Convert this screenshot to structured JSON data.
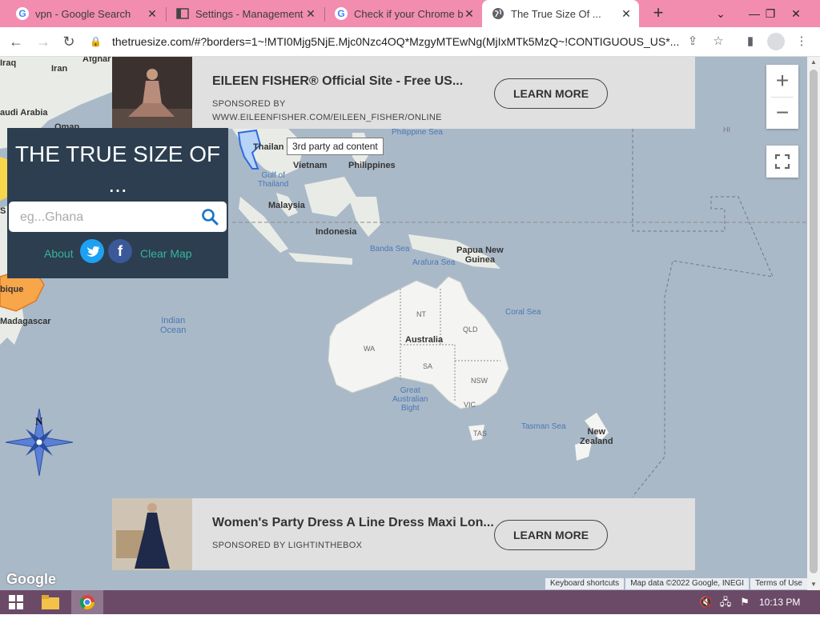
{
  "browser": {
    "tabs": [
      {
        "title": "vpn - Google Search",
        "icon": "google-icon",
        "active": false
      },
      {
        "title": "Settings - Management",
        "icon": "settings-page-icon",
        "active": false
      },
      {
        "title": "Check if your Chrome br",
        "icon": "google-icon",
        "active": false
      },
      {
        "title": "The True Size Of ...",
        "icon": "globe-icon",
        "active": true
      }
    ],
    "url": "thetruesize.com/#?borders=1~!MTI0Mjg5NjE.Mjc0Nzc4OQ*MzgyMTEwNg(MjIxMTk5MzQ~!CONTIGUOUS_US*..."
  },
  "site": {
    "panel_title": "THE TRUE SIZE OF ...",
    "search_placeholder": "eg...Ghana",
    "about_label": "About",
    "clear_label": "Clear Map"
  },
  "ads": {
    "top": {
      "title": "EILEEN FISHER® Official Site - Free US...",
      "sponsor_line1": "SPONSORED BY",
      "sponsor_line2": "WWW.EILEENFISHER.COM/EILEEN_FISHER/ONLINE",
      "cta": "LEARN MORE"
    },
    "bottom": {
      "title": "Women's Party Dress A Line Dress Maxi Lon...",
      "sponsor_line1": "SPONSORED BY LIGHTINTHEBOX",
      "cta": "LEARN MORE"
    },
    "tooltip": "3rd party ad content"
  },
  "map": {
    "labels": {
      "iraq": "Iraq",
      "iran": "Iran",
      "afghan": "Afghar",
      "saudi": "audi Arabia",
      "oman": "Oman",
      "thailand": "Thailan",
      "gulf_thailand": "Gulf of\nThailand",
      "vietnam": "Vietnam",
      "philippines": "Philippines",
      "philippine_sea": "Philippine Sea",
      "malaysia": "Malaysia",
      "indonesia": "Indonesia",
      "banda_sea": "Banda Sea",
      "arafura_sea": "Arafura Sea",
      "png": "Papua New\nGuinea",
      "coral_sea": "Coral Sea",
      "indian_ocean": "Indian\nOcean",
      "australia": "Australia",
      "nt": "NT",
      "qld": "QLD",
      "wa": "WA",
      "sa": "SA",
      "nsw": "NSW",
      "vic": "VIC",
      "tas": "TAS",
      "bight": "Great\nAustralian\nBight",
      "tasman": "Tasman Sea",
      "nz": "New\nZealand",
      "madagascar": "Madagascar",
      "mozambique": "bique",
      "hi": "HI",
      "compass_n": "N",
      "s_partial": "S"
    },
    "google_logo": "Google",
    "attribution": {
      "shortcuts": "Keyboard shortcuts",
      "data": "Map data ©2022 Google, INEGI",
      "terms": "Terms of Use"
    }
  },
  "taskbar": {
    "time": "10:13 PM"
  },
  "colors": {
    "tab_bar": "#f28db0",
    "panel": "#2c3e50",
    "panel_link": "#35b59e",
    "twitter": "#1da1f2",
    "facebook": "#3b5998",
    "ocean": "#aab9c8",
    "taskbar": "#6b4a68"
  }
}
